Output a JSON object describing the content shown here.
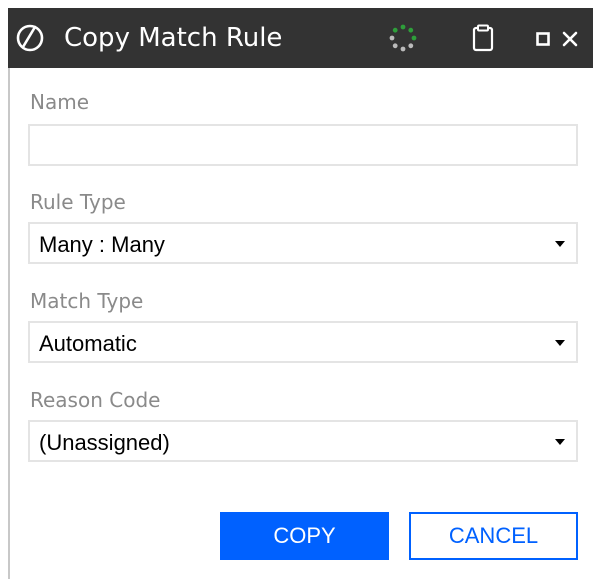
{
  "dialog": {
    "title": "Copy Match Rule",
    "icons": {
      "logo": "app-logo-icon",
      "spinner": "loading-spinner-icon",
      "clipboard": "clipboard-icon",
      "maximize": "maximize-icon",
      "close": "close-icon"
    }
  },
  "form": {
    "name": {
      "label": "Name",
      "value": "",
      "placeholder": ""
    },
    "rule_type": {
      "label": "Rule Type",
      "selected": "Many : Many"
    },
    "match_type": {
      "label": "Match Type",
      "selected": "Automatic"
    },
    "reason_code": {
      "label": "Reason Code",
      "selected": "(Unassigned)"
    }
  },
  "buttons": {
    "copy_label": "COPY",
    "cancel_label": "CANCEL"
  },
  "colors": {
    "titlebar_bg": "#333333",
    "accent": "#0061ff",
    "label_text": "#8a8a8a",
    "spinner_green": "#2e9e3a",
    "spinner_gray": "#bbbbbb"
  }
}
